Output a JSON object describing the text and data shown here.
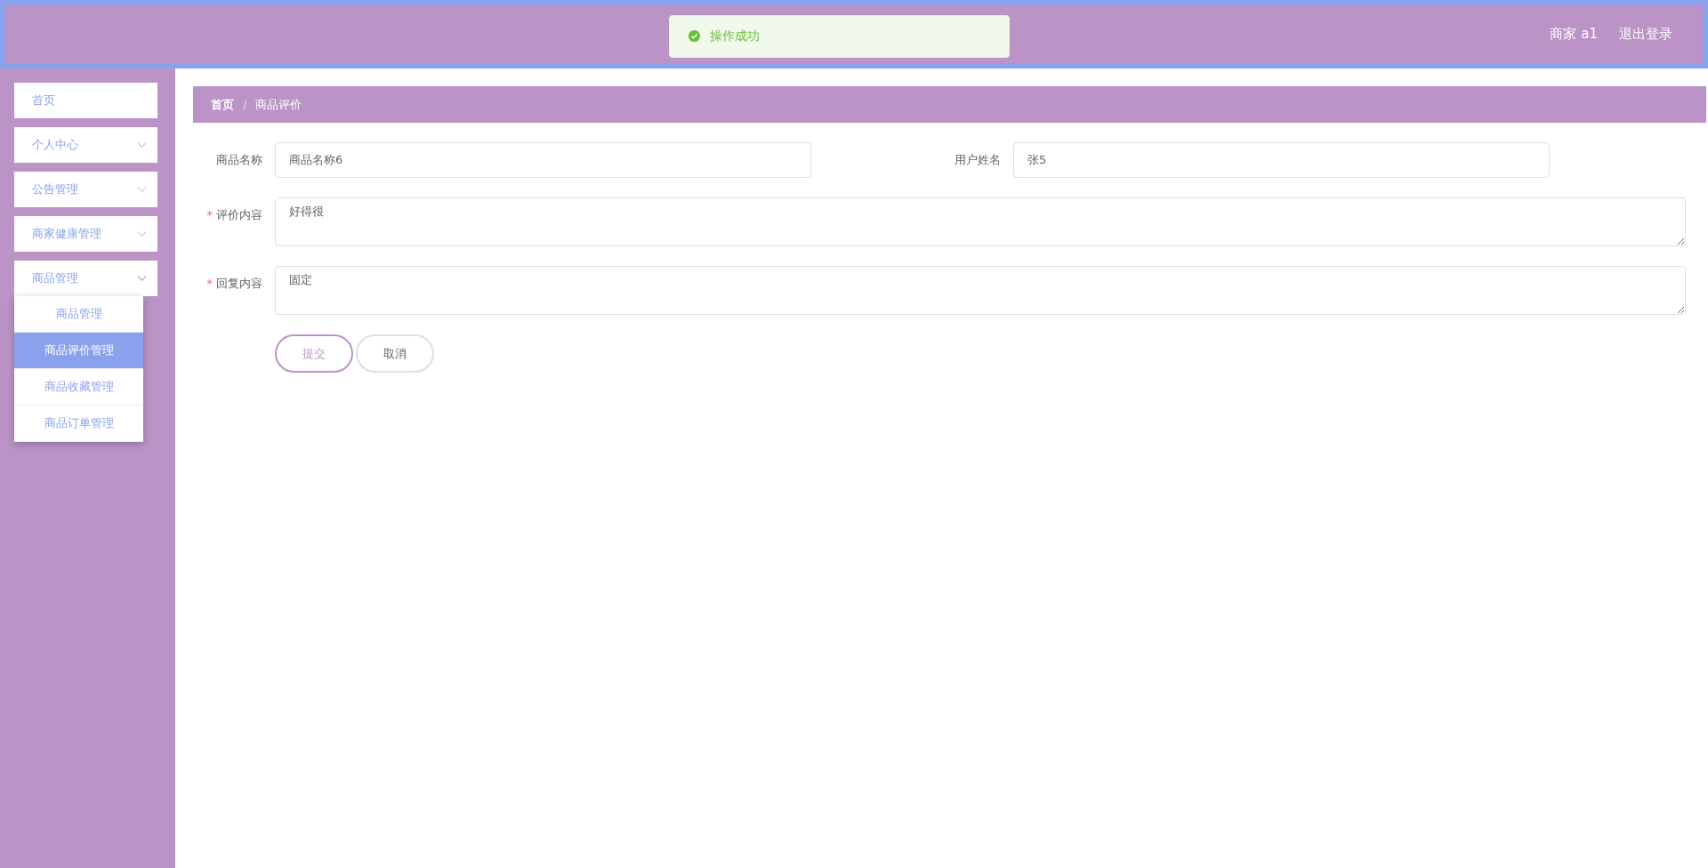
{
  "header": {
    "user": "商家 a1",
    "logout": "退出登录"
  },
  "toast": {
    "kind": "success",
    "message": "操作成功"
  },
  "sidebar": {
    "items": [
      {
        "label": "首页",
        "kind": "link"
      },
      {
        "label": "个人中心",
        "kind": "menu",
        "expanded": false
      },
      {
        "label": "公告管理",
        "kind": "menu",
        "expanded": false
      },
      {
        "label": "商家健康管理",
        "kind": "menu",
        "expanded": false
      },
      {
        "label": "商品管理",
        "kind": "menu",
        "expanded": true,
        "children": [
          {
            "label": "商品管理",
            "selected": false
          },
          {
            "label": "商品评价管理",
            "selected": true
          },
          {
            "label": "商品收藏管理",
            "selected": false
          },
          {
            "label": "商品订单管理",
            "selected": false
          }
        ]
      }
    ]
  },
  "breadcrumb": [
    "首页",
    "商品评价"
  ],
  "breadcrumb_separator": "/",
  "form": {
    "rows": [
      [
        {
          "label": "商品名称",
          "value": "商品名称6",
          "kind": "input"
        },
        {
          "label": "用户姓名",
          "value": "张5",
          "kind": "input"
        }
      ],
      [
        {
          "label": "评价内容",
          "value": "好得很",
          "kind": "textarea",
          "marker": "*"
        }
      ],
      [
        {
          "label": "回复内容",
          "value": "固定",
          "kind": "textarea",
          "marker": "*"
        }
      ]
    ],
    "buttons": [
      {
        "label": "提交",
        "kind": "primary"
      },
      {
        "label": "取消",
        "kind": "default"
      }
    ]
  }
}
